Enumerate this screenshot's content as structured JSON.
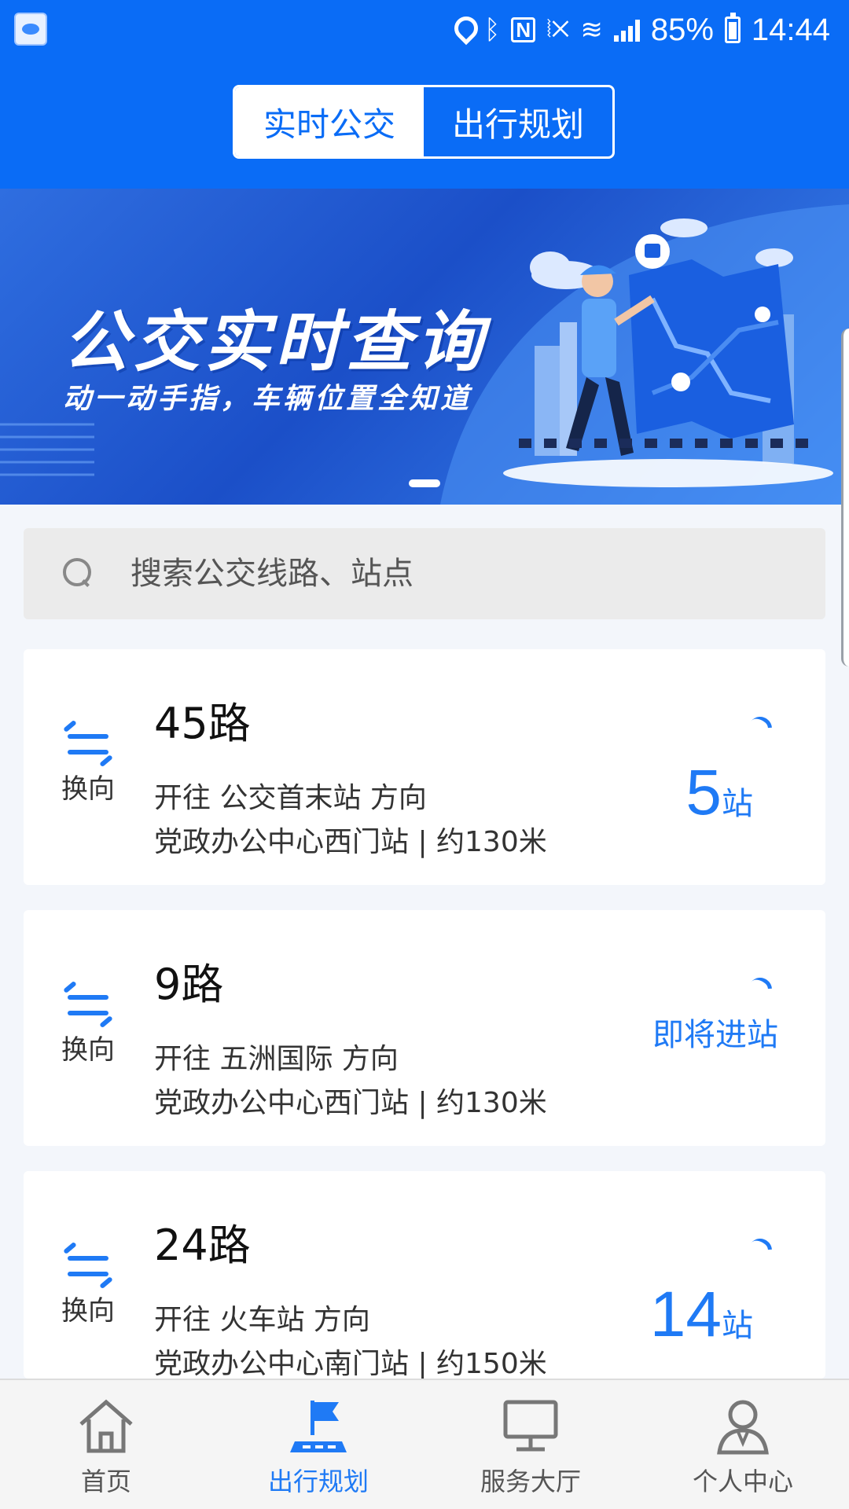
{
  "status_bar": {
    "battery": "85%",
    "time": "14:44",
    "icons": [
      "app-icon",
      "location-icon",
      "bluetooth-icon",
      "nfc-icon",
      "vibrate-icon",
      "wifi-icon",
      "signal-icon",
      "battery-charging-icon"
    ]
  },
  "header": {
    "tabs": [
      {
        "label": "实时公交",
        "active": true
      },
      {
        "label": "出行规划",
        "active": false
      }
    ]
  },
  "banner": {
    "title": "公交实时查询",
    "subtitle": "动一动手指，车辆位置全知道",
    "page_indicator": {
      "current": 1,
      "total": 1
    }
  },
  "search": {
    "placeholder": "搜索公交线路、站点",
    "value": ""
  },
  "routes": [
    {
      "swap_label": "换向",
      "name": "45路",
      "direction": "开往 公交首末站 方向",
      "stop": "党政办公中心西门站 | 约130米",
      "eta_num": "5",
      "eta_unit": "站"
    },
    {
      "swap_label": "换向",
      "name": "9路",
      "direction": "开往 五洲国际 方向",
      "stop": "党政办公中心西门站 | 约130米",
      "eta_text": "即将进站"
    },
    {
      "swap_label": "换向",
      "name": "24路",
      "direction": "开往 火车站 方向",
      "stop": "党政办公中心南门站 | 约150米",
      "eta_num": "14",
      "eta_unit": "站"
    }
  ],
  "bottom_nav": [
    {
      "label": "首页",
      "icon": "home-icon",
      "active": false
    },
    {
      "label": "出行规划",
      "icon": "flag-road-icon",
      "active": true
    },
    {
      "label": "服务大厅",
      "icon": "monitor-icon",
      "active": false
    },
    {
      "label": "个人中心",
      "icon": "person-icon",
      "active": false
    }
  ],
  "colors": {
    "primary": "#0a6cf6",
    "accent": "#1f7af5",
    "background": "#f3f6fb"
  }
}
